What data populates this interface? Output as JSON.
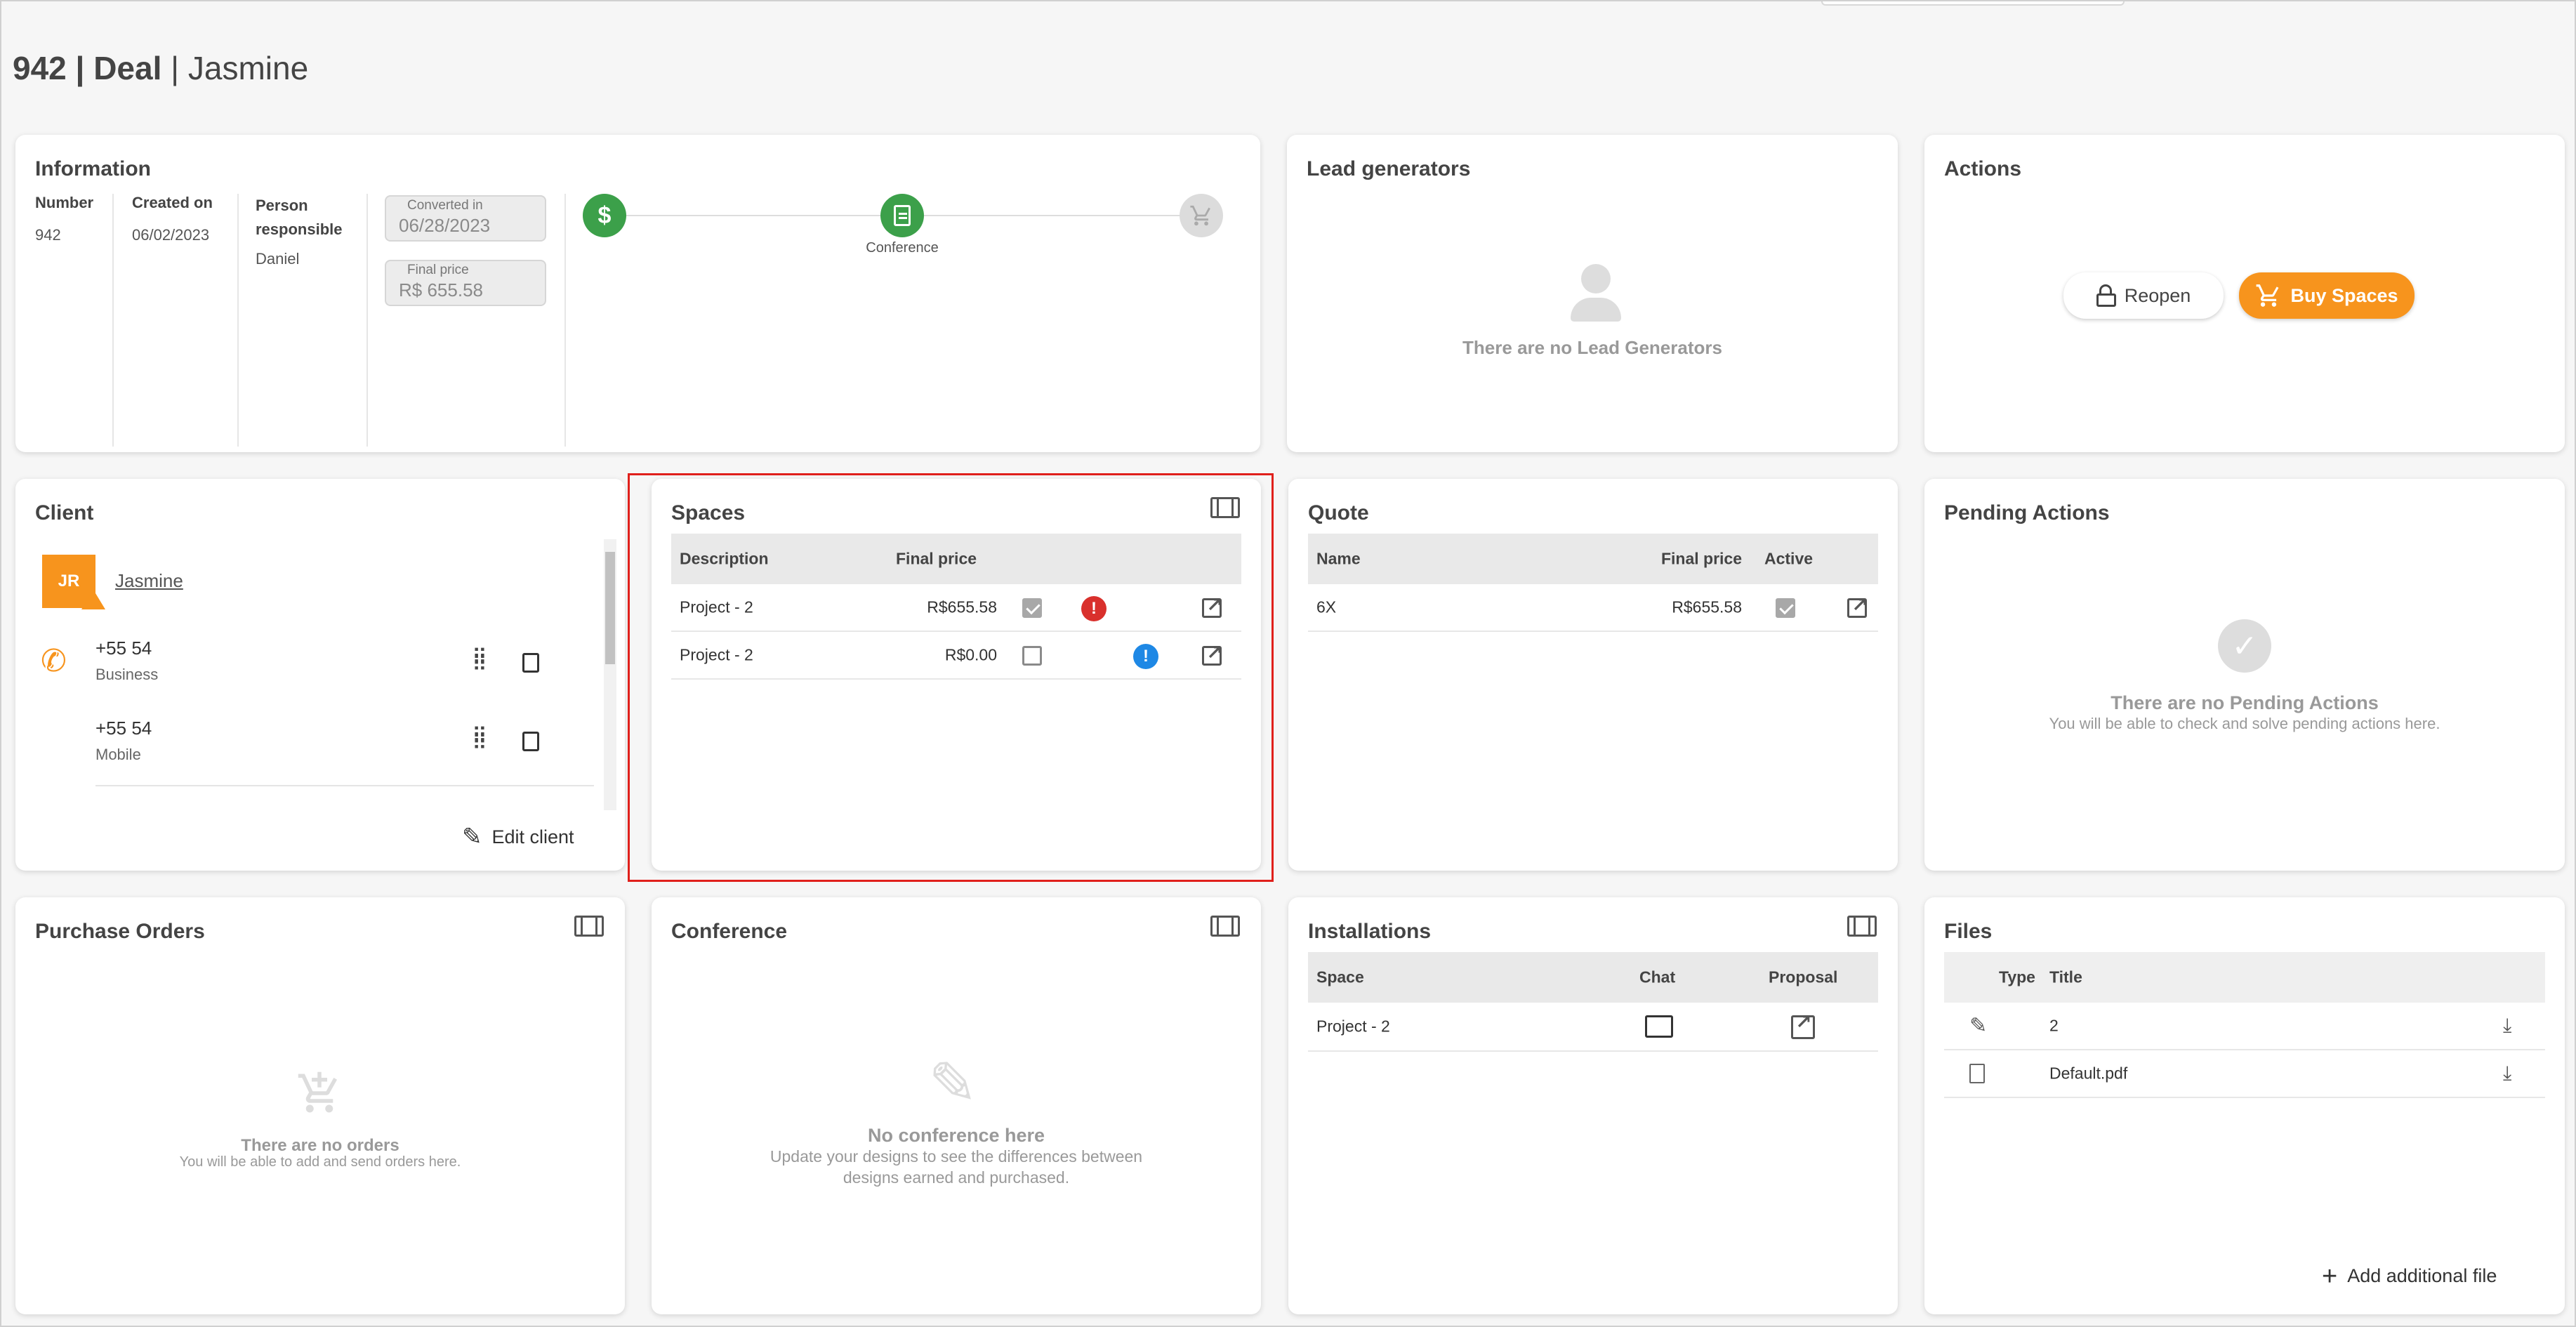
{
  "header": {
    "deal_number": "942",
    "sep1": " | ",
    "deal_label": "Deal",
    "sep2": " | ",
    "client_name": "Jasmine"
  },
  "information": {
    "title": "Information",
    "number_label": "Number",
    "number_value": "942",
    "created_label": "Created on",
    "created_value": "06/02/2023",
    "person_label_1": "Person",
    "person_label_2": "responsible",
    "person_value": "Daniel",
    "converted_label": "Converted in",
    "converted_value": "06/28/2023",
    "final_price_label": "Final price",
    "final_price_value": "R$ 655.58",
    "stage_label": "Conference"
  },
  "lead_generators": {
    "title": "Lead generators",
    "empty_text": "There are no Lead Generators"
  },
  "actions": {
    "title": "Actions",
    "reopen_label": "Reopen",
    "buy_label": "Buy Spaces"
  },
  "client": {
    "title": "Client",
    "initials": "JR",
    "name": "Jasmine",
    "phones": [
      {
        "number": "+55 54",
        "type": "Business"
      },
      {
        "number": "+55 54",
        "type": "Mobile"
      }
    ],
    "edit_label": "Edit client"
  },
  "spaces": {
    "title": "Spaces",
    "col_description": "Description",
    "col_final_price": "Final price",
    "rows": [
      {
        "description": "Project - 2",
        "price": "R$655.58",
        "checked": true,
        "status": "error"
      },
      {
        "description": "Project - 2",
        "price": "R$0.00",
        "checked": false,
        "status": "info"
      }
    ]
  },
  "quote": {
    "title": "Quote",
    "col_name": "Name",
    "col_final_price": "Final price",
    "col_active": "Active",
    "rows": [
      {
        "name": "6X",
        "price": "R$655.58",
        "active": true
      }
    ]
  },
  "pending": {
    "title": "Pending Actions",
    "empty_title": "There are no Pending Actions",
    "empty_sub": "You will be able to check and solve pending actions here."
  },
  "purchase_orders": {
    "title": "Purchase Orders",
    "empty_title": "There are no orders",
    "empty_sub": "You will be able to add and send orders here."
  },
  "conference": {
    "title": "Conference",
    "empty_title": "No conference here",
    "empty_sub_1": "Update your designs to see the differences between",
    "empty_sub_2": "designs earned and purchased."
  },
  "installations": {
    "title": "Installations",
    "col_space": "Space",
    "col_chat": "Chat",
    "col_proposal": "Proposal",
    "rows": [
      {
        "space": "Project - 2"
      }
    ]
  },
  "files": {
    "title": "Files",
    "col_type": "Type",
    "col_title": "Title",
    "rows": [
      {
        "title": "2",
        "type_icon": "design-tool-icon"
      },
      {
        "title": "Default.pdf",
        "type_icon": "pdf-file-icon"
      }
    ],
    "add_label": "Add additional file"
  },
  "colors": {
    "accent_orange": "#f7941d",
    "green": "#3ca04a",
    "error_red": "#d9302c",
    "info_blue": "#1e88e5",
    "highlight_red": "#e0201c"
  }
}
